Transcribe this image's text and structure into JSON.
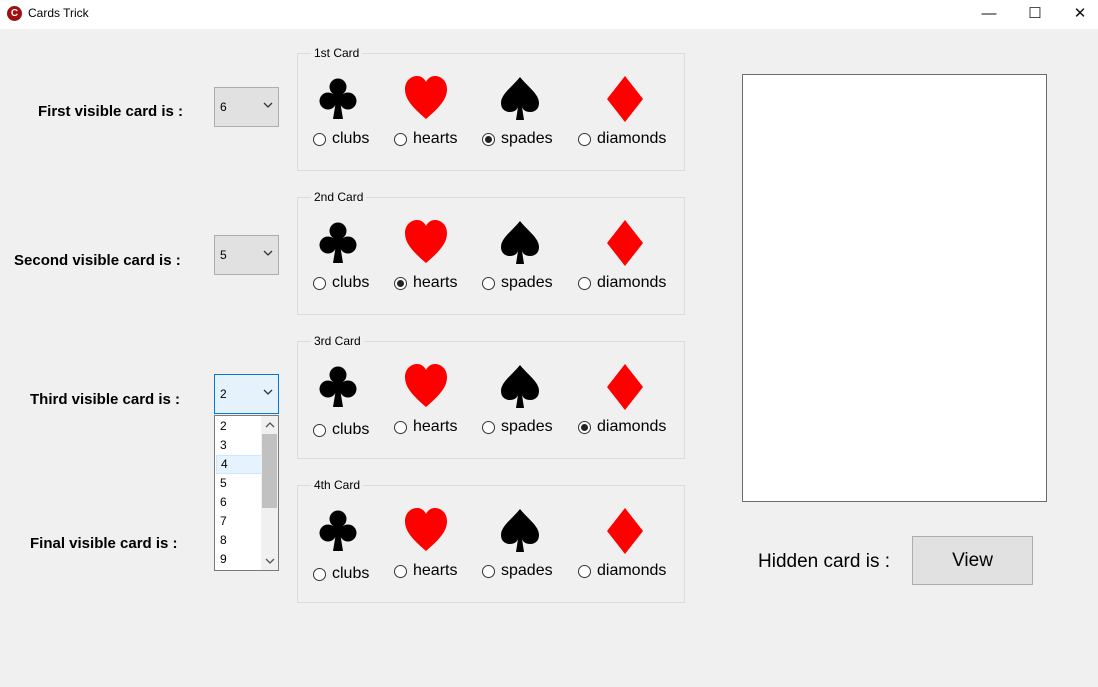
{
  "window": {
    "title": "Cards Trick",
    "minimize_glyph": "—",
    "maximize_glyph": "☐",
    "close_glyph": "✕"
  },
  "colors": {
    "red_suit": "#ff0000",
    "black_suit": "#000000"
  },
  "suit_icons": [
    "clubs-icon",
    "hearts-icon",
    "spades-icon",
    "diamonds-icon"
  ],
  "rows": [
    {
      "label": "First visible card is :",
      "value": "6",
      "group_caption": "1st Card",
      "options": [
        "clubs",
        "hearts",
        "spades",
        "diamonds"
      ],
      "selected": "spades"
    },
    {
      "label": "Second visible card is :",
      "value": "5",
      "group_caption": "2nd Card",
      "options": [
        "clubs",
        "hearts",
        "spades",
        "diamonds"
      ],
      "selected": "hearts"
    },
    {
      "label": "Third visible card is :",
      "value": "2",
      "group_caption": "3rd Card",
      "options": [
        "clubs",
        "hearts",
        "spades",
        "diamonds"
      ],
      "selected": "diamonds"
    },
    {
      "label": "Final visible card is :",
      "value": "",
      "group_caption": "4th Card",
      "options": [
        "clubs",
        "hearts",
        "spades",
        "diamonds"
      ],
      "selected": ""
    }
  ],
  "dropdown": {
    "items": [
      "2",
      "3",
      "4",
      "5",
      "6",
      "7",
      "8",
      "9"
    ],
    "highlighted": "4"
  },
  "hidden_card_label": "Hidden card is :",
  "view_button_label": "View"
}
